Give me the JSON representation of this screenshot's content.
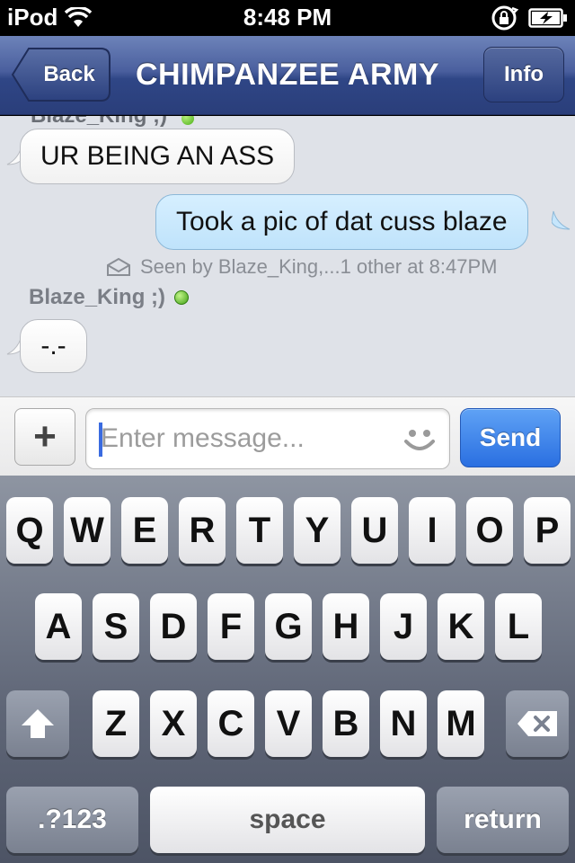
{
  "status_bar": {
    "carrier": "iPod",
    "time": "8:48 PM",
    "icons": [
      "wifi-icon",
      "orientation-lock-icon",
      "battery-charging-icon"
    ]
  },
  "nav": {
    "back_label": "Back",
    "title": "CHIMPANZEE ARMY",
    "info_label": "Info"
  },
  "chat": {
    "clipped_sender": "Blaze_King ;)",
    "messages": [
      {
        "direction": "incoming",
        "text": "UR BEING AN ASS"
      },
      {
        "direction": "outgoing",
        "text": "Took a pic of dat cuss blaze"
      },
      {
        "direction": "incoming",
        "text": "-.-"
      }
    ],
    "seen_text": "Seen by Blaze_King,...1 other at 8:47PM",
    "sender_name": "Blaze_King ;)",
    "colors": {
      "incoming_bubble": "#ffffff",
      "outgoing_bubble": "#cde9fd",
      "online": "#4caf1a"
    }
  },
  "input": {
    "plus_label": "+",
    "placeholder": "Enter message...",
    "value": "",
    "send_label": "Send"
  },
  "keyboard": {
    "row1": [
      "Q",
      "W",
      "E",
      "R",
      "T",
      "Y",
      "U",
      "I",
      "O",
      "P"
    ],
    "row2": [
      "A",
      "S",
      "D",
      "F",
      "G",
      "H",
      "J",
      "K",
      "L"
    ],
    "row3": [
      "Z",
      "X",
      "C",
      "V",
      "B",
      "N",
      "M"
    ],
    "numbers_label": ".?123",
    "space_label": "space",
    "return_label": "return"
  }
}
